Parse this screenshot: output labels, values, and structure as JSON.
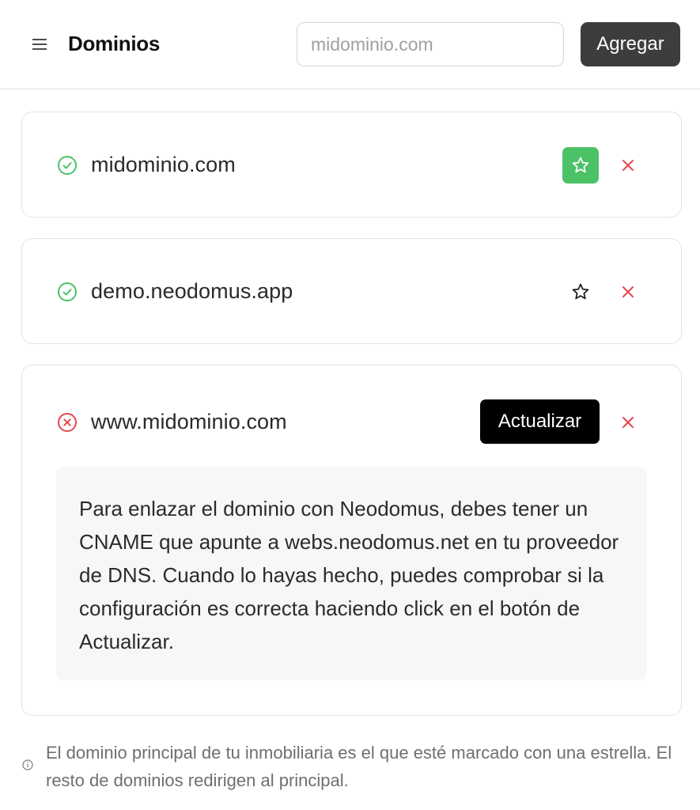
{
  "header": {
    "menu_icon": "menu-icon",
    "title": "Dominios",
    "search_placeholder": "midominio.com",
    "search_value": "",
    "add_label": "Agregar"
  },
  "domains": [
    {
      "name": "midominio.com",
      "status": "verified",
      "status_icon": "check-circle-icon",
      "primary": true,
      "delete_icon": "close-icon"
    },
    {
      "name": "demo.neodomus.app",
      "status": "verified",
      "status_icon": "check-circle-icon",
      "primary": false,
      "delete_icon": "close-icon"
    },
    {
      "name": "www.midominio.com",
      "status": "error",
      "status_icon": "x-circle-icon",
      "update_label": "Actualizar",
      "help_text": "Para enlazar el dominio con Neodomus, debes tener un CNAME que apunte a webs.neodomus.net en tu proveedor de DNS. Cuando lo hayas hecho, puedes comprobar si la configuración es correcta haciendo click en el botón de Actualizar.",
      "delete_icon": "close-icon"
    }
  ],
  "footnote": {
    "icon": "info-icon",
    "text": "El dominio principal de tu inmobiliaria es el que esté marcado con una estrella. El resto de dominios redirigen al principal."
  },
  "colors": {
    "success": "#4cc267",
    "error": "#e5484d",
    "primary_star_bg": "#4cc267",
    "add_button_bg": "#3d3d3d",
    "update_button_bg": "#000000"
  }
}
